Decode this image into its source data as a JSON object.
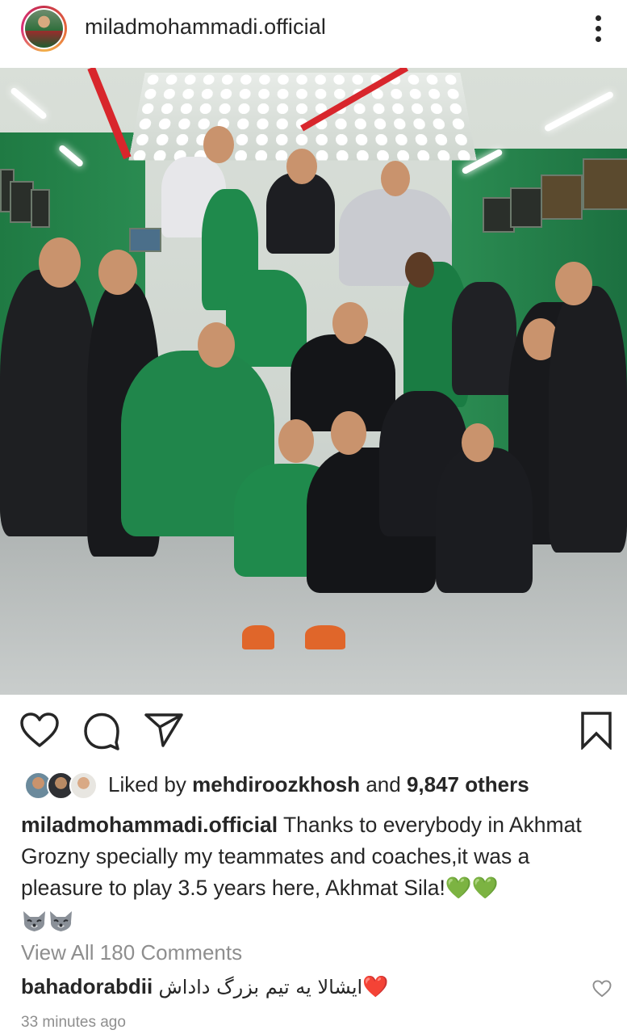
{
  "post": {
    "username": "miladmohammadi.official",
    "more_icon": "more-vertical-icon",
    "photo_icon": "team-photo"
  },
  "actions": {
    "like_icon": "heart-outline-icon",
    "comment_icon": "comment-bubble-icon",
    "share_icon": "paper-plane-icon",
    "save_icon": "bookmark-icon"
  },
  "likes": {
    "prefix": "Liked by",
    "user": "mehdiroozkhosh",
    "and": "and",
    "others": "9,847 others"
  },
  "caption": {
    "username": "miladmohammadi.official",
    "text": "Thanks to everybody in Akhmat Grozny specially my teammates and coaches,it was a pleasure to play 3.5 years here, Akhmat Sila!",
    "hearts": "💚💚"
  },
  "comments": {
    "view_all": "View All 180 Comments",
    "items": [
      {
        "username": "bahadorabdii",
        "text": "ایشالا یه تیم بزرگ داداش",
        "emoji": "❤️"
      }
    ]
  },
  "timestamp": "33 minutes ago"
}
